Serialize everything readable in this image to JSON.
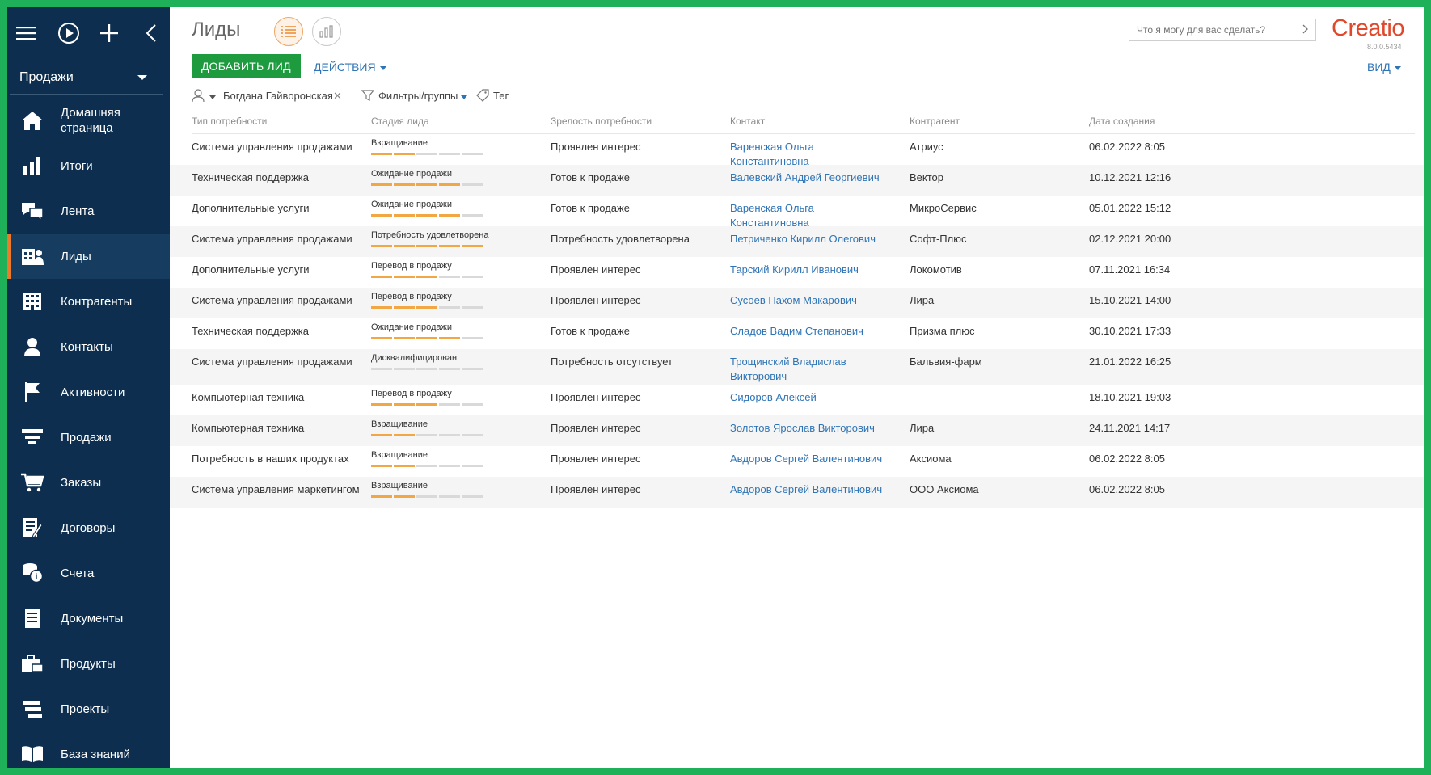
{
  "sidebar": {
    "workspace": "Продажи",
    "items": [
      {
        "label": "Домашняя страница",
        "icon": "home-icon",
        "active": false
      },
      {
        "label": "Итоги",
        "icon": "bar-chart-icon",
        "active": false
      },
      {
        "label": "Лента",
        "icon": "chat-bubbles-icon",
        "active": false
      },
      {
        "label": "Лиды",
        "icon": "leads-icon",
        "active": true
      },
      {
        "label": "Контрагенты",
        "icon": "building-icon",
        "active": false
      },
      {
        "label": "Контакты",
        "icon": "person-icon",
        "active": false
      },
      {
        "label": "Активности",
        "icon": "flag-icon",
        "active": false
      },
      {
        "label": "Продажи",
        "icon": "funnel-icon",
        "active": false
      },
      {
        "label": "Заказы",
        "icon": "cart-icon",
        "active": false
      },
      {
        "label": "Договоры",
        "icon": "contract-icon",
        "active": false
      },
      {
        "label": "Счета",
        "icon": "coins-icon",
        "active": false
      },
      {
        "label": "Документы",
        "icon": "document-icon",
        "active": false
      },
      {
        "label": "Продукты",
        "icon": "products-icon",
        "active": false
      },
      {
        "label": "Проекты",
        "icon": "projects-icon",
        "active": false
      },
      {
        "label": "База знаний",
        "icon": "book-icon",
        "active": false
      }
    ]
  },
  "header": {
    "title": "Лиды",
    "add_button": "ДОБАВИТЬ ЛИД",
    "actions": "ДЕЙСТВИЯ",
    "view": "ВИД",
    "search_placeholder": "Что я могу для вас сделать?",
    "logo": "Creatio",
    "version": "8.0.0.5434"
  },
  "filters": {
    "user": "Богдана Гайворонская",
    "filters_groups": "Фильтры/группы",
    "tag": "Тег"
  },
  "colors": {
    "sidebar_bg": "#0d2e4e",
    "accent_orange": "#ec7a2a",
    "add_button_green": "#1e9a3f",
    "link_blue": "#2f74b5",
    "stage_bar_on": "#f2a745",
    "logo_red": "#e1472b"
  },
  "table": {
    "columns": [
      "Тип потребности",
      "Стадия лида",
      "Зрелость потребности",
      "Контакт",
      "Контрагент",
      "Дата создания"
    ],
    "rows": [
      {
        "need": "Система управления продажами",
        "stage": "Взращивание",
        "stage_level": 2,
        "maturity": "Проявлен интерес",
        "contact": "Варенская Ольга Константиновна",
        "account": "Атриус",
        "date": "06.02.2022 8:05"
      },
      {
        "need": "Техническая поддержка",
        "stage": "Ожидание продажи",
        "stage_level": 4,
        "maturity": "Готов к продаже",
        "contact": "Валевский Андрей Георгиевич",
        "account": "Вектор",
        "date": "10.12.2021 12:16"
      },
      {
        "need": "Дополнительные услуги",
        "stage": "Ожидание продажи",
        "stage_level": 4,
        "maturity": "Готов к продаже",
        "contact": "Варенская Ольга Константиновна",
        "account": "МикроСервис",
        "date": "05.01.2022 15:12"
      },
      {
        "need": "Система управления продажами",
        "stage": "Потребность удовлетворена",
        "stage_level": 5,
        "maturity": "Потребность удовлетворена",
        "contact": "Петриченко Кирилл Олегович",
        "account": "Софт-Плюс",
        "date": "02.12.2021 20:00"
      },
      {
        "need": "Дополнительные услуги",
        "stage": "Перевод в продажу",
        "stage_level": 3,
        "maturity": "Проявлен интерес",
        "contact": "Тарский Кирилл Иванович",
        "account": "Локомотив",
        "date": "07.11.2021 16:34"
      },
      {
        "need": "Система управления продажами",
        "stage": "Перевод в продажу",
        "stage_level": 3,
        "maturity": "Проявлен интерес",
        "contact": "Сусоев Пахом Макарович",
        "account": "Лира",
        "date": "15.10.2021 14:00"
      },
      {
        "need": "Техническая поддержка",
        "stage": "Ожидание продажи",
        "stage_level": 4,
        "maturity": "Готов к продаже",
        "contact": "Сладов Вадим Степанович",
        "account": "Призма плюс",
        "date": "30.10.2021 17:33"
      },
      {
        "need": "Система управления продажами",
        "stage": "Дисквалифицирован",
        "stage_level": 0,
        "maturity": "Потребность отсутствует",
        "contact": "Трощинский Владислав Викторович",
        "account": "Бальвия-фарм",
        "date": "21.01.2022 16:25"
      },
      {
        "need": "Компьютерная техника",
        "stage": "Перевод в продажу",
        "stage_level": 3,
        "maturity": "Проявлен интерес",
        "contact": "Сидоров Алексей",
        "account": "",
        "date": "18.10.2021 19:03"
      },
      {
        "need": "Компьютерная техника",
        "stage": "Взращивание",
        "stage_level": 2,
        "maturity": "Проявлен интерес",
        "contact": "Золотов Ярослав Викторович",
        "account": "Лира",
        "date": "24.11.2021 14:17"
      },
      {
        "need": "Потребность в наших продуктах",
        "stage": "Взращивание",
        "stage_level": 2,
        "maturity": "Проявлен интерес",
        "contact": "Авдоров Сергей Валентинович",
        "account": "Аксиома",
        "date": "06.02.2022 8:05"
      },
      {
        "need": "Система управления маркетингом",
        "stage": "Взращивание",
        "stage_level": 2,
        "maturity": "Проявлен интерес",
        "contact": "Авдоров Сергей Валентинович",
        "account": "ООО Аксиома",
        "date": "06.02.2022 8:05"
      }
    ]
  }
}
